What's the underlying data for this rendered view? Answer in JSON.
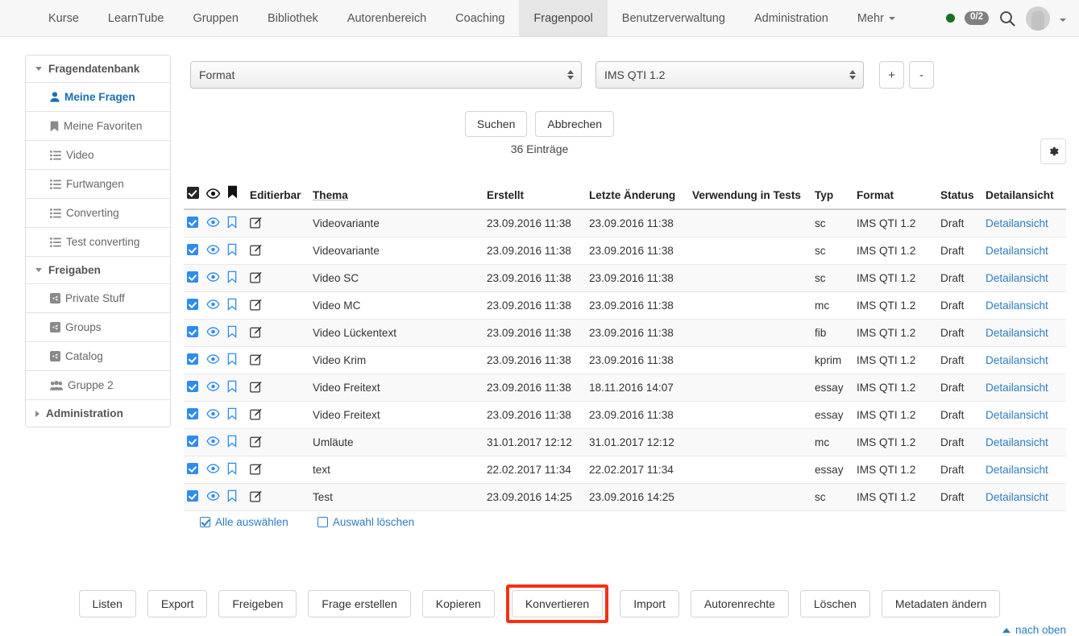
{
  "nav": {
    "items": [
      {
        "label": "Kurse",
        "active": false
      },
      {
        "label": "LearnTube",
        "active": false
      },
      {
        "label": "Gruppen",
        "active": false
      },
      {
        "label": "Bibliothek",
        "active": false
      },
      {
        "label": "Autorenbereich",
        "active": false
      },
      {
        "label": "Coaching",
        "active": false
      },
      {
        "label": "Fragenpool",
        "active": true
      },
      {
        "label": "Benutzerverwaltung",
        "active": false
      },
      {
        "label": "Administration",
        "active": false
      },
      {
        "label": "Mehr",
        "active": false,
        "caret": true
      }
    ],
    "status_dot_color": "#15701f",
    "badge": "0/2",
    "search_icon": "search-icon",
    "avatar_icon": "avatar"
  },
  "sidebar": {
    "groups": [
      {
        "label": "Fragendatenbank",
        "expanded": true,
        "items": [
          {
            "label": "Meine Fragen",
            "icon": "user-icon",
            "selected": true
          },
          {
            "label": "Meine Favoriten",
            "icon": "bookmark-icon",
            "selected": false
          },
          {
            "label": "Video",
            "icon": "list-icon",
            "selected": false
          },
          {
            "label": "Furtwangen",
            "icon": "list-icon",
            "selected": false
          },
          {
            "label": "Converting",
            "icon": "list-icon",
            "selected": false
          },
          {
            "label": "Test converting",
            "icon": "list-icon",
            "selected": false
          }
        ]
      },
      {
        "label": "Freigaben",
        "expanded": true,
        "items": [
          {
            "label": "Private Stuff",
            "icon": "share-icon",
            "selected": false
          },
          {
            "label": "Groups",
            "icon": "share-icon",
            "selected": false
          },
          {
            "label": "Catalog",
            "icon": "share-icon",
            "selected": false
          },
          {
            "label": "Gruppe 2",
            "icon": "group-icon",
            "selected": false
          }
        ]
      },
      {
        "label": "Administration",
        "expanded": false,
        "items": []
      }
    ]
  },
  "filters": {
    "format_select_value": "Format",
    "qti_select_value": "IMS QTI 1.2",
    "add_label": "+",
    "remove_label": "-",
    "search_label": "Suchen",
    "cancel_label": "Abbrechen"
  },
  "results": {
    "entries_text": "36 Einträge",
    "settings_icon": "gear-icon"
  },
  "table": {
    "headers": {
      "select_all": "select-all-checkbox",
      "preview": "eye-icon",
      "favorite": "bookmark-icon",
      "editierbar": "Editierbar",
      "thema": "Thema",
      "erstellt": "Erstellt",
      "letzte_aenderung": "Letzte Änderung",
      "verwendung": "Verwendung in Tests",
      "typ": "Typ",
      "format": "Format",
      "status": "Status",
      "detailansicht": "Detailansicht"
    },
    "rows": [
      {
        "checked": true,
        "thema": "Videovariante",
        "erstellt": "23.09.2016 11:38",
        "geaendert": "23.09.2016 11:38",
        "verwendung": "",
        "typ": "sc",
        "format": "IMS QTI 1.2",
        "status": "Draft",
        "detail": "Detailansicht"
      },
      {
        "checked": true,
        "thema": "Videovariante",
        "erstellt": "23.09.2016 11:38",
        "geaendert": "23.09.2016 11:38",
        "verwendung": "",
        "typ": "sc",
        "format": "IMS QTI 1.2",
        "status": "Draft",
        "detail": "Detailansicht"
      },
      {
        "checked": true,
        "thema": "Video SC",
        "erstellt": "23.09.2016 11:38",
        "geaendert": "23.09.2016 11:38",
        "verwendung": "",
        "typ": "sc",
        "format": "IMS QTI 1.2",
        "status": "Draft",
        "detail": "Detailansicht"
      },
      {
        "checked": true,
        "thema": "Video MC",
        "erstellt": "23.09.2016 11:38",
        "geaendert": "23.09.2016 11:38",
        "verwendung": "",
        "typ": "mc",
        "format": "IMS QTI 1.2",
        "status": "Draft",
        "detail": "Detailansicht"
      },
      {
        "checked": true,
        "thema": "Video Lückentext",
        "erstellt": "23.09.2016 11:38",
        "geaendert": "23.09.2016 11:38",
        "verwendung": "",
        "typ": "fib",
        "format": "IMS QTI 1.2",
        "status": "Draft",
        "detail": "Detailansicht"
      },
      {
        "checked": true,
        "thema": "Video Krim",
        "erstellt": "23.09.2016 11:38",
        "geaendert": "23.09.2016 11:38",
        "verwendung": "",
        "typ": "kprim",
        "format": "IMS QTI 1.2",
        "status": "Draft",
        "detail": "Detailansicht"
      },
      {
        "checked": true,
        "thema": "Video Freitext",
        "erstellt": "23.09.2016 11:38",
        "geaendert": "18.11.2016 14:07",
        "verwendung": "",
        "typ": "essay",
        "format": "IMS QTI 1.2",
        "status": "Draft",
        "detail": "Detailansicht"
      },
      {
        "checked": true,
        "thema": "Video Freitext",
        "erstellt": "23.09.2016 11:38",
        "geaendert": "23.09.2016 11:38",
        "verwendung": "",
        "typ": "essay",
        "format": "IMS QTI 1.2",
        "status": "Draft",
        "detail": "Detailansicht"
      },
      {
        "checked": true,
        "thema": "Umläute",
        "erstellt": "31.01.2017 12:12",
        "geaendert": "31.01.2017 12:12",
        "verwendung": "",
        "typ": "mc",
        "format": "IMS QTI 1.2",
        "status": "Draft",
        "detail": "Detailansicht"
      },
      {
        "checked": true,
        "thema": "text",
        "erstellt": "22.02.2017 11:34",
        "geaendert": "22.02.2017 11:34",
        "verwendung": "",
        "typ": "essay",
        "format": "IMS QTI 1.2",
        "status": "Draft",
        "detail": "Detailansicht"
      },
      {
        "checked": true,
        "thema": "Test",
        "erstellt": "23.09.2016 14:25",
        "geaendert": "23.09.2016 14:25",
        "verwendung": "",
        "typ": "sc",
        "format": "IMS QTI 1.2",
        "status": "Draft",
        "detail": "Detailansicht"
      }
    ]
  },
  "selection": {
    "select_all_label": "Alle auswählen",
    "select_all_checked": true,
    "clear_label": "Auswahl löschen",
    "clear_checked": false
  },
  "actions": {
    "buttons": [
      {
        "label": "Listen",
        "highlighted": false
      },
      {
        "label": "Export",
        "highlighted": false
      },
      {
        "label": "Freigeben",
        "highlighted": false
      },
      {
        "label": "Frage erstellen",
        "highlighted": false
      },
      {
        "label": "Kopieren",
        "highlighted": false
      },
      {
        "label": "Konvertieren",
        "highlighted": true
      },
      {
        "label": "Import",
        "highlighted": false
      },
      {
        "label": "Autorenrechte",
        "highlighted": false
      },
      {
        "label": "Löschen",
        "highlighted": false
      },
      {
        "label": "Metadaten ändern",
        "highlighted": false
      }
    ],
    "highlight_color": "#f62f14"
  },
  "footer": {
    "back_to_top": "nach oben"
  }
}
